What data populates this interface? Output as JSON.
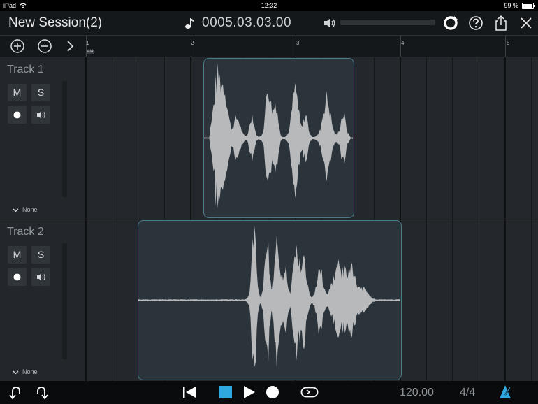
{
  "status_bar": {
    "carrier": "iPad",
    "time": "12:32",
    "battery_text": "99 %",
    "battery_level": 0.99
  },
  "header": {
    "session_title": "New Session(2)",
    "position": "0005.03.03.00",
    "volume_level": 0,
    "icons": [
      "note-icon",
      "speaker-icon",
      "loop-circle-icon",
      "help-icon",
      "share-icon",
      "close-icon"
    ]
  },
  "toolbar": {
    "icons": [
      "zoom-in-icon",
      "zoom-out-icon",
      "chevron-right-icon"
    ]
  },
  "ruler": {
    "bars": [
      "1",
      "2",
      "3",
      "4",
      "5"
    ],
    "time_signature_chip": "4/4"
  },
  "tracks": [
    {
      "name": "Track 1",
      "mute_label": "M",
      "solo_label": "S",
      "output": "None"
    },
    {
      "name": "Track 2",
      "mute_label": "M",
      "solo_label": "S",
      "output": "None"
    }
  ],
  "transport": {
    "icons": [
      "undo-icon",
      "redo-icon",
      "rewind-to-start-icon",
      "stop-icon",
      "play-icon",
      "record-icon",
      "loop-icon",
      "metronome-icon"
    ],
    "tempo": "120.00",
    "time_signature": "4/4"
  },
  "colors": {
    "accent": "#2fa8e0",
    "clip_border": "#4b7c8c",
    "waveform": "#b7b9bb",
    "background": "#1f2326"
  }
}
